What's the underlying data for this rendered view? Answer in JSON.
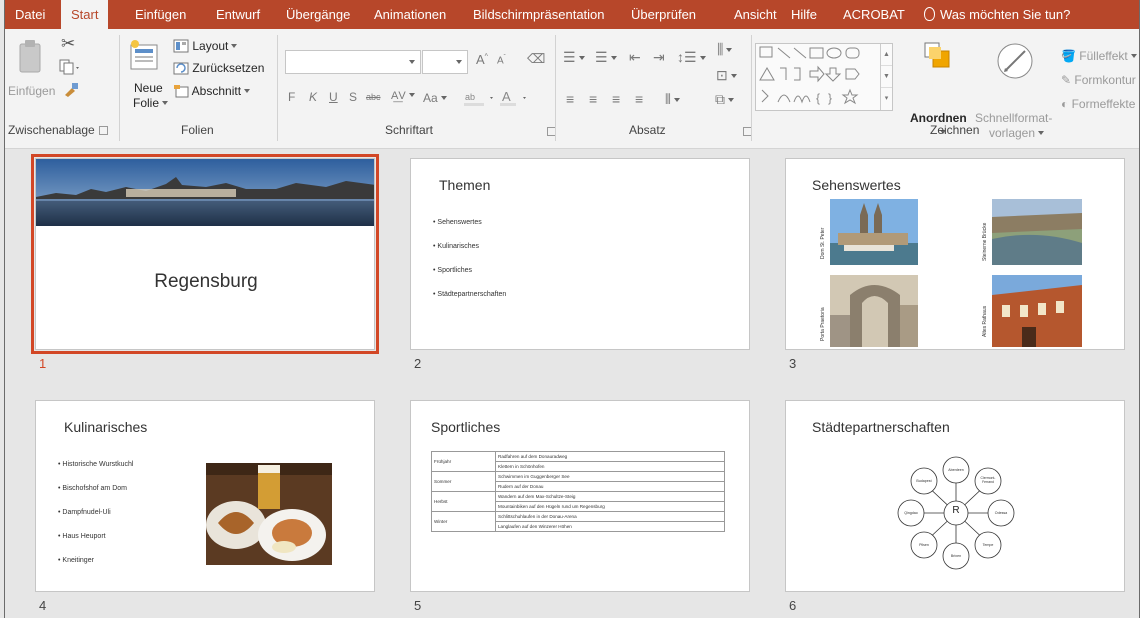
{
  "menu_tabs": [
    "Datei",
    "Start",
    "Einfügen",
    "Entwurf",
    "Übergänge",
    "Animationen",
    "Bildschirmpräsentation",
    "Überprüfen",
    "Ansicht",
    "Hilfe",
    "ACROBAT",
    "Was möchten Sie tun?"
  ],
  "active_tab": "Start",
  "ribbon": {
    "clipboard": {
      "paste": "Einfügen",
      "group": "Zwischenablage"
    },
    "slides": {
      "new_slide_1": "Neue",
      "new_slide_2": "Folie",
      "layout": "Layout",
      "reset": "Zurücksetzen",
      "section": "Abschnitt",
      "group": "Folien"
    },
    "font": {
      "group": "Schriftart",
      "bold": "F",
      "italic": "K",
      "underline": "U",
      "strike": "S",
      "strike2": "abc",
      "case": "Aa",
      "grow": "A",
      "shrink": "A"
    },
    "paragraph": {
      "group": "Absatz"
    },
    "drawing": {
      "arrange": "Anordnen",
      "quick_styles_1": "Schnellformat-",
      "quick_styles_2": "vorlagen",
      "fill": "Fülleffekt",
      "outline": "Formkontur",
      "effects": "Formeffekte",
      "group": "Zeichnen"
    }
  },
  "slides": [
    {
      "number": "1",
      "title": "Regensburg",
      "selected": true
    },
    {
      "number": "2",
      "title": "Themen",
      "bullets": [
        "Sehenswertes",
        "Kulinarisches",
        "Sportliches",
        "Städtepartnerschaften"
      ]
    },
    {
      "number": "3",
      "title": "Sehenswertes",
      "captions": [
        "Dom St. Peter",
        "Steinerne Brücke",
        "Porta Praetoria",
        "Altes Rathaus"
      ]
    },
    {
      "number": "4",
      "title": "Kulinarisches",
      "bullets": [
        "Historische Wurstkuchl",
        "Bischofshof am Dom",
        "Dampfnudel-Uli",
        "Haus Heuport",
        "Kneitinger"
      ]
    },
    {
      "number": "5",
      "title": "Sportliches",
      "rows": [
        {
          "season": "Frühjahr",
          "a": "Radfahren auf dem Donauradweg",
          "b": "Klettern in Schönhofen"
        },
        {
          "season": "Sommer",
          "a": "Schwimmen im Guggenberger See",
          "b": "Rudern auf der Donau"
        },
        {
          "season": "Herbst",
          "a": "Wandern auf dem Max-Schultze-Steig",
          "b": "Mountainbiken auf den Hügeln rund um Regensburg"
        },
        {
          "season": "Winter",
          "a": "Schlittschuhlaufen in der Donau-Arena",
          "b": "Langlaufen auf den Winzerer Höhen"
        }
      ]
    },
    {
      "number": "6",
      "title": "Städtepartnerschaften",
      "center": "R",
      "cities": [
        "Aberdeen",
        "Clermont-Ferrand",
        "Odessa",
        "Tempe",
        "Brixen",
        "Pilsen",
        "Qingdao",
        "Budapest"
      ]
    }
  ]
}
